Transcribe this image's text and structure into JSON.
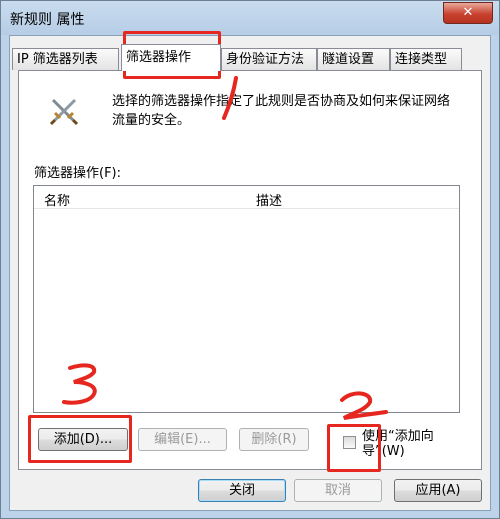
{
  "window": {
    "title": "新规则 属性",
    "close": "✕"
  },
  "tabs": [
    {
      "label": "IP 筛选器列表"
    },
    {
      "label": "筛选器操作",
      "active": true
    },
    {
      "label": "身份验证方法"
    },
    {
      "label": "隧道设置"
    },
    {
      "label": "连接类型"
    }
  ],
  "panel": {
    "icon": "crossed-swords-icon",
    "description": "选择的筛选器操作指定了此规则是否协商及如何来保证网络流量的安全。",
    "list_label": "筛选器操作(F):",
    "columns": [
      "名称",
      "描述"
    ],
    "rows": []
  },
  "buttons": {
    "add": "添加(D)...",
    "edit": "编辑(E)...",
    "remove": "删除(R)",
    "wizard_checkbox_label": "使用“添加向导”(W)",
    "close": "关闭",
    "cancel": "取消",
    "apply": "应用(A)"
  },
  "annotations": [
    "1",
    "2",
    "3"
  ],
  "colors": {
    "annotation": "#e5271f",
    "title_bar": "#bcd3ea",
    "close_button": "#c7422f"
  }
}
